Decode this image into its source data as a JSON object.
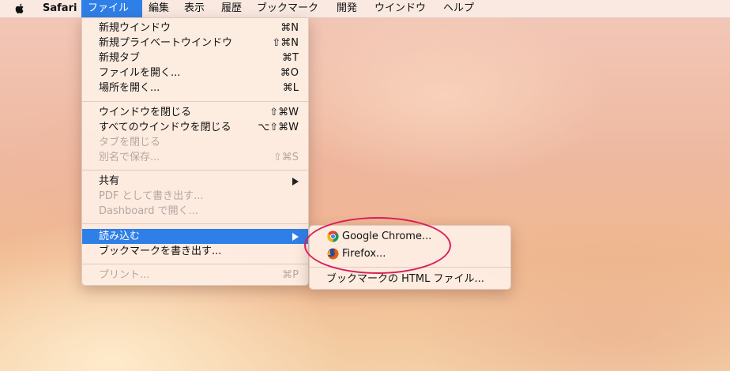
{
  "menubar": {
    "apple_icon": "apple-logo",
    "items": [
      "Safari",
      "ファイル",
      "編集",
      "表示",
      "履歴",
      "ブックマーク",
      "開発",
      "ウインドウ",
      "ヘルプ"
    ]
  },
  "file_menu": {
    "groups": [
      [
        {
          "label": "新規ウインドウ",
          "shortcut": "⌘N",
          "enabled": true
        },
        {
          "label": "新規プライベートウインドウ",
          "shortcut": "⇧⌘N",
          "enabled": true
        },
        {
          "label": "新規タブ",
          "shortcut": "⌘T",
          "enabled": true
        },
        {
          "label": "ファイルを開く...",
          "shortcut": "⌘O",
          "enabled": true
        },
        {
          "label": "場所を開く...",
          "shortcut": "⌘L",
          "enabled": true
        }
      ],
      [
        {
          "label": "ウインドウを閉じる",
          "shortcut": "⇧⌘W",
          "enabled": true
        },
        {
          "label": "すべてのウインドウを閉じる",
          "shortcut": "⌥⇧⌘W",
          "enabled": true
        },
        {
          "label": "タブを閉じる",
          "shortcut": "",
          "enabled": false
        },
        {
          "label": "別名で保存...",
          "shortcut": "⇧⌘S",
          "enabled": false
        }
      ],
      [
        {
          "label": "共有",
          "submenu": true,
          "enabled": true
        },
        {
          "label": "PDF として書き出す...",
          "shortcut": "",
          "enabled": false
        },
        {
          "label": "Dashboard で開く...",
          "shortcut": "",
          "enabled": false
        }
      ],
      [
        {
          "label": "読み込む",
          "submenu": true,
          "enabled": true,
          "highlighted": true
        },
        {
          "label": "ブックマークを書き出す...",
          "shortcut": "",
          "enabled": true
        }
      ],
      [
        {
          "label": "プリント...",
          "shortcut": "⌘P",
          "enabled": false
        }
      ]
    ]
  },
  "import_submenu": {
    "items": [
      {
        "label": "Google Chrome...",
        "icon": "chrome-icon"
      },
      {
        "label": "Firefox...",
        "icon": "firefox-icon"
      }
    ],
    "separator_after": 1,
    "bookmarks_file": "ブックマークの HTML ファイル..."
  },
  "colors": {
    "highlight": "#2f7fe8",
    "annotation": "#d81e5b"
  }
}
